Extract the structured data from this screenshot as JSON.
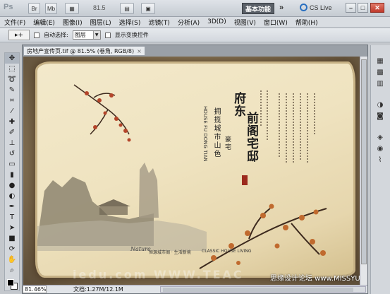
{
  "app": {
    "logo": "Ps",
    "bar_buttons": [
      "Mb",
      "Br"
    ],
    "zoom": "81.5",
    "workspace": "基本功能",
    "expand": "»",
    "cs_live": "CS Live",
    "window_buttons": [
      "–",
      "□",
      "✕"
    ]
  },
  "menu": {
    "items": [
      "文件(F)",
      "编辑(E)",
      "图像(I)",
      "图层(L)",
      "选择(S)",
      "滤镜(T)",
      "分析(A)",
      "3D(D)",
      "视图(V)",
      "窗口(W)",
      "帮助(H)"
    ]
  },
  "options": {
    "tool_preset": "▸+",
    "auto_select_label": "自动选择:",
    "auto_select_value": "图层",
    "show_transform_label": "显示变换控件"
  },
  "document": {
    "tab_title": "房地产宣传页.tif @ 81.5% (卷角, RGB/8)",
    "tab_close": "×",
    "zoom_field": "81.46%",
    "doc_info": "文档:1.27M/12.1M"
  },
  "poster": {
    "title_line1": "府东",
    "title_line2": "前阁宅邸",
    "subtitle1": "拥揽城市山色",
    "subtitle2": "豪宅",
    "english": "HOUSE FU DONG TIAN",
    "footer_en": "CLASSIC HOUSE LIVING",
    "logo_en": "Nature",
    "logo_cn": "恒源城市阁 · 生活新境"
  },
  "watermark": "思缘设计论坛 www.MISSYUAN.com",
  "watermark_faint": "iedu.com WWW.TEAC"
}
